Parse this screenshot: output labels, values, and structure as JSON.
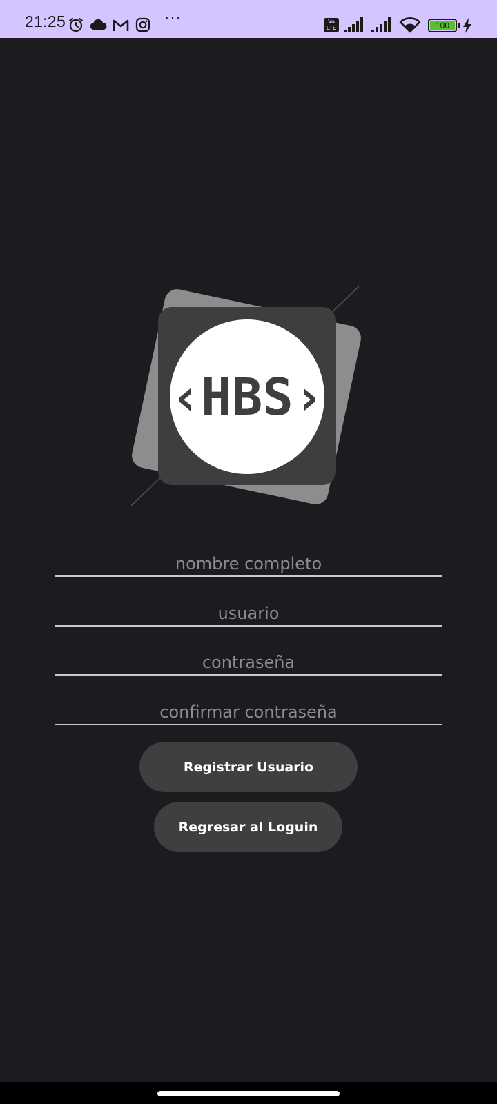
{
  "status_bar": {
    "time": "21:25",
    "more": "···",
    "volte": "Vo LTE",
    "battery": "100"
  },
  "logo": {
    "text": "‹HBS›"
  },
  "form": {
    "full_name_placeholder": "nombre completo",
    "username_placeholder": "usuario",
    "password_placeholder": "contraseña",
    "confirm_password_placeholder": "confirmar contraseña"
  },
  "buttons": {
    "register_label": "Registrar Usuario",
    "back_to_login_label": "Regresar al Loguin"
  },
  "colors": {
    "status_bar": "#d4c4ff",
    "background": "#1c1b20",
    "button": "#3f3f40",
    "battery": "#59c12b"
  },
  "icons": {
    "status_bar": [
      "alarm-icon",
      "cloud-icon",
      "gmail-icon",
      "instagram-icon",
      "signal-icon",
      "wifi-icon",
      "battery-icon",
      "charging-icon"
    ]
  }
}
